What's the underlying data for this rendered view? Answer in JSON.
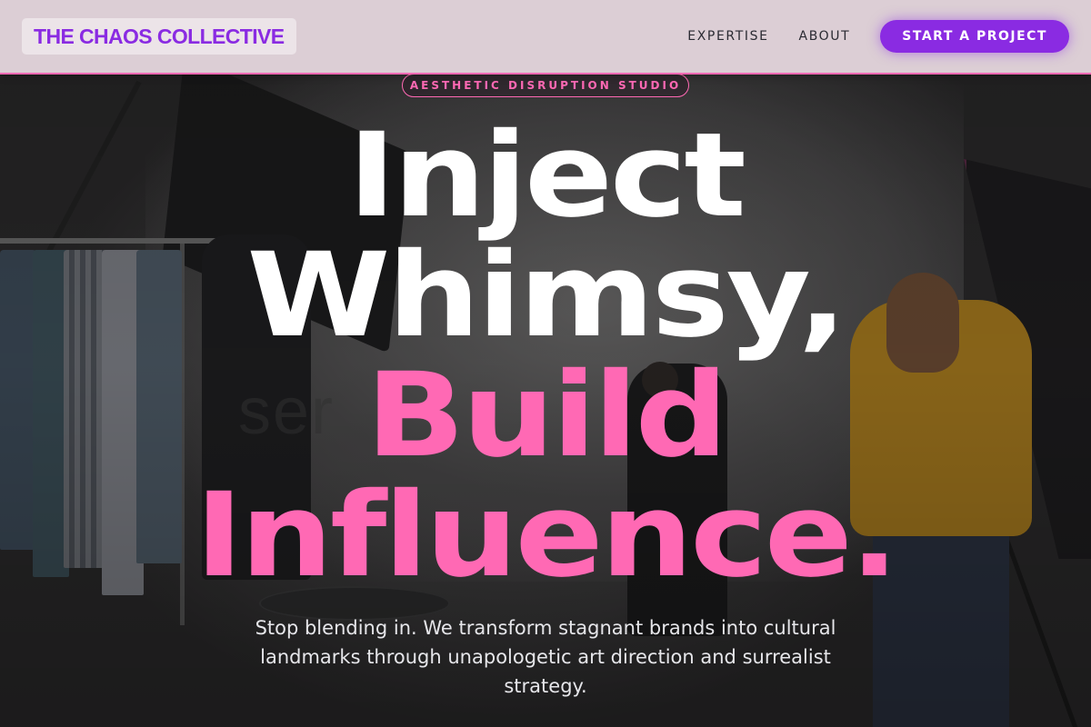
{
  "header": {
    "logo": "THE CHAOS COLLECTIVE",
    "nav": [
      {
        "label": "EXPERTISE"
      },
      {
        "label": "ABOUT"
      }
    ],
    "cta": "START A PROJECT"
  },
  "hero": {
    "tag": "AESTHETIC DISRUPTION STUDIO",
    "headline": {
      "line1": "Inject",
      "line2": "Whimsy,",
      "line3": "Build",
      "line4": "Influence."
    },
    "subtext": "Stop blending in. We transform stagnant brands into cultural landmarks through unapologetic art direction and surrealist strategy.",
    "background_wall_text": "ser"
  },
  "colors": {
    "brand_purple": "#8a2be2",
    "accent_pink": "#ff69b4",
    "header_bg": "#dcced5"
  }
}
